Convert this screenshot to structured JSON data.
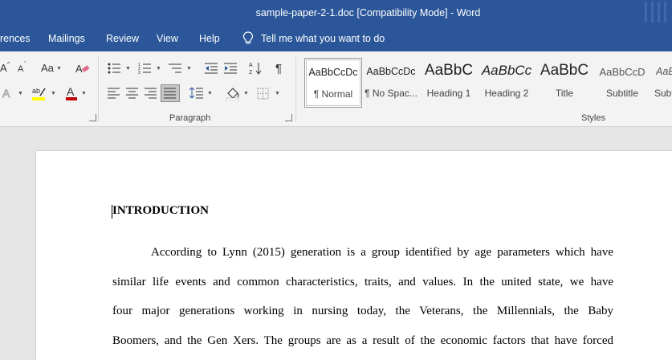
{
  "titlebar": {
    "title": "sample-paper-2-1.doc [Compatibility Mode]  -  Word"
  },
  "menu": {
    "tabs": [
      "rences",
      "Mailings",
      "Review",
      "View",
      "Help"
    ],
    "tell_me": "Tell me what you want to do"
  },
  "ribbon": {
    "font_group": {
      "change_case": "Aa"
    },
    "paragraph_label": "Paragraph",
    "styles_label": "Styles",
    "styles": [
      {
        "sample": "AaBbCcDc",
        "name": "¶ Normal"
      },
      {
        "sample": "AaBbCcDc",
        "name": "¶ No Spac..."
      },
      {
        "sample": "AaBbC",
        "name": "Heading 1"
      },
      {
        "sample": "AaBbCc",
        "name": "Heading 2"
      },
      {
        "sample": "AaBbC",
        "name": "Title"
      },
      {
        "sample": "AaBbCcD",
        "name": "Subtitle"
      },
      {
        "sample": "AaBl",
        "name": "Subtl"
      }
    ]
  },
  "document": {
    "heading": "INTRODUCTION",
    "lines": [
      "According to Lynn (2015)  generation is a group identified by age parameters which have",
      "similar life events and common characteristics, traits, and values. In the united state, we have",
      "four major generations working in nursing today, the Veterans,  the Millennials, the Baby",
      "Boomers,  and the Gen Xers. The groups are as a result of the economic factors that have forced"
    ]
  },
  "colors": {
    "brand": "#2b579a",
    "highlight": "#ffff00",
    "font_color": "#c00000"
  }
}
